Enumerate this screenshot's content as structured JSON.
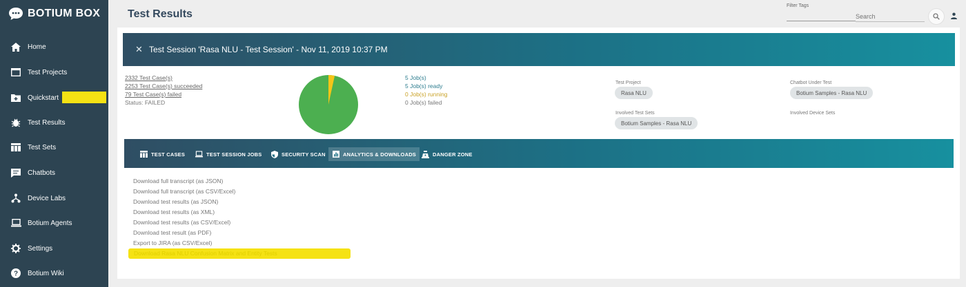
{
  "app": {
    "name": "BOTIUM BOX"
  },
  "sidebar": {
    "items": [
      {
        "label": "Home",
        "icon": "home-icon"
      },
      {
        "label": "Test Projects",
        "icon": "folder-icon"
      },
      {
        "label": "Quickstart",
        "icon": "folder-plus-icon"
      },
      {
        "label": "Test Results",
        "icon": "bug-icon"
      },
      {
        "label": "Test Sets",
        "icon": "table-icon"
      },
      {
        "label": "Chatbots",
        "icon": "chat-icon"
      },
      {
        "label": "Device Labs",
        "icon": "network-icon"
      },
      {
        "label": "Botium Agents",
        "icon": "laptop-icon"
      },
      {
        "label": "Settings",
        "icon": "gear-icon"
      },
      {
        "label": "Botium Wiki",
        "icon": "help-icon"
      }
    ],
    "highlight_color": "#f5e214"
  },
  "header": {
    "title": "Test Results",
    "filter_label": "Filter Tags",
    "search_placeholder": "Search"
  },
  "session": {
    "title": "Test Session 'Rasa NLU - Test Session' - Nov 11, 2019 10:37 PM",
    "stats": {
      "test_cases": "2332 Test Case(s)",
      "succeeded": "2253 Test Case(s) succeeded",
      "failed": "79 Test Case(s) failed",
      "status": "Status: FAILED"
    },
    "pie": {
      "succeeded": 2253,
      "failed": 79,
      "succeeded_color": "#4caf50",
      "failed_color": "#f5c518"
    },
    "jobs": {
      "total": "5 Job(s)",
      "ready": "5 Job(s) ready",
      "running": "0 Job(s) running",
      "failed": "0 Job(s) failed"
    },
    "test_project": {
      "label": "Test Project",
      "value": "Rasa NLU"
    },
    "chatbot": {
      "label": "Chatbot Under Test",
      "value": "Botium Samples - Rasa NLU"
    },
    "test_sets": {
      "label": "Involved Test Sets",
      "value": "Botium Samples - Rasa NLU"
    },
    "device_sets": {
      "label": "Involved Device Sets"
    }
  },
  "tabs": [
    {
      "label": "TEST CASES",
      "icon": "table-icon",
      "active": false
    },
    {
      "label": "TEST SESSION JOBS",
      "icon": "laptop-icon",
      "active": false
    },
    {
      "label": "SECURITY SCAN",
      "icon": "shield-icon",
      "active": false
    },
    {
      "label": "ANALYTICS & DOWNLOADS",
      "icon": "chart-icon",
      "active": true
    },
    {
      "label": "DANGER ZONE",
      "icon": "warning-icon",
      "active": false
    }
  ],
  "downloads": [
    "Download full transcript (as JSON)",
    "Download full transcript (as CSV/Excel)",
    "Download test results (as JSON)",
    "Download test results (as XML)",
    "Download test results (as CSV/Excel)",
    "Download test result (as PDF)",
    "Export to JIRA (as CSV/Excel)",
    "Download Rasa NLU Confusion Matrix and Entity Tests"
  ],
  "colors": {
    "sidebar_bg": "#2d4452",
    "accent_start": "#2f4e63",
    "accent_end": "#17909f",
    "highlight": "#f5e214",
    "running": "#c9a227",
    "ready": "#2e7d8f"
  }
}
